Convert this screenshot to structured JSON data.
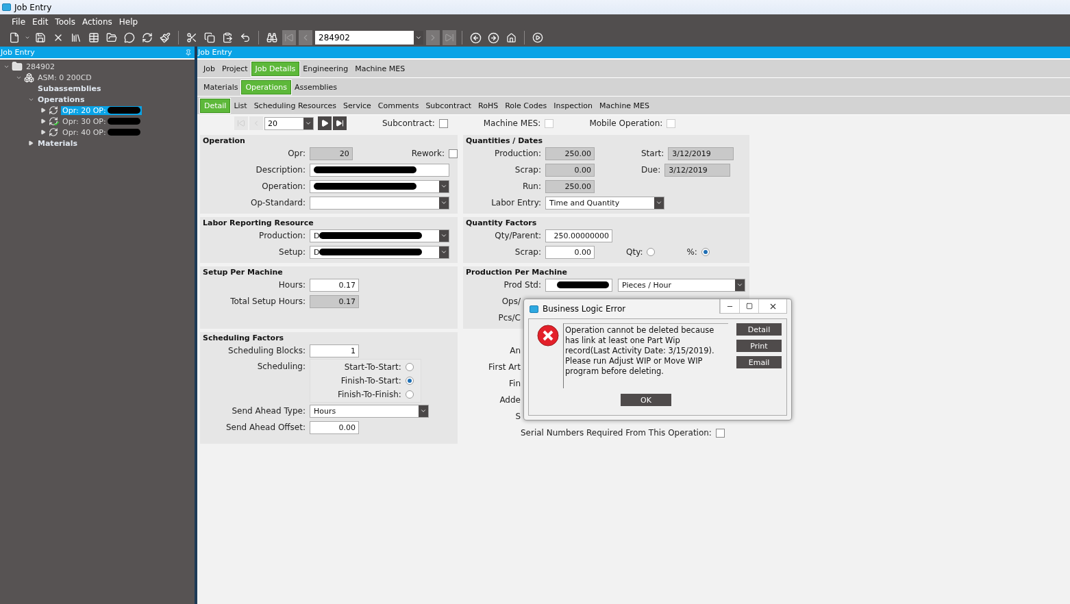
{
  "window": {
    "title": "Job Entry"
  },
  "menu": [
    "File",
    "Edit",
    "Tools",
    "Actions",
    "Help"
  ],
  "toolbar": {
    "job_number": "284902"
  },
  "tree_panel": {
    "title": "Job Entry",
    "tree": [
      {
        "label": "284902",
        "kind": "job",
        "expanded": true,
        "children": [
          {
            "label": "ASM: 0 200CD",
            "kind": "assembly",
            "expanded": true,
            "children": [
              {
                "label": "Subassemblies",
                "kind": "group"
              },
              {
                "label": "Operations",
                "kind": "group",
                "expanded": true,
                "children": [
                  {
                    "label": "Opr: 20 OP:",
                    "kind": "operation",
                    "expanded": false,
                    "selected": true,
                    "complete": false
                  },
                  {
                    "label": "Opr: 30 OP:",
                    "kind": "operation",
                    "expanded": false,
                    "selected": false,
                    "complete": true
                  },
                  {
                    "label": "Opr: 40 OP:",
                    "kind": "operation",
                    "expanded": false,
                    "selected": false,
                    "complete": false
                  }
                ]
              },
              {
                "label": "Materials",
                "kind": "group",
                "expanded": false
              }
            ]
          }
        ]
      }
    ]
  },
  "main_panel": {
    "title": "Job Entry",
    "tab_rows": [
      [
        {
          "label": "Job",
          "selected": false
        },
        {
          "label": "Project",
          "selected": false
        },
        {
          "label": "Job Details",
          "selected": true
        },
        {
          "label": "Engineering",
          "selected": false
        },
        {
          "label": "Machine MES",
          "selected": false
        }
      ],
      [
        {
          "label": "Materials",
          "selected": false
        },
        {
          "label": "Operations",
          "selected": true
        },
        {
          "label": "Assemblies",
          "selected": false
        }
      ],
      [
        {
          "label": "Detail",
          "selected": true
        },
        {
          "label": "List",
          "selected": false
        },
        {
          "label": "Scheduling Resources",
          "selected": false
        },
        {
          "label": "Service",
          "selected": false
        },
        {
          "label": "Comments",
          "selected": false
        },
        {
          "label": "Subcontract",
          "selected": false
        },
        {
          "label": "RoHS",
          "selected": false
        },
        {
          "label": "Role Codes",
          "selected": false
        },
        {
          "label": "Inspection",
          "selected": false
        },
        {
          "label": "Machine MES",
          "selected": false
        }
      ]
    ],
    "navigator": {
      "value": "20",
      "options": [
        {
          "label": "Subcontract:",
          "checked": false,
          "disabled": false
        },
        {
          "label": "Machine MES:",
          "checked": false,
          "disabled": true
        },
        {
          "label": "Mobile Operation:",
          "checked": false,
          "disabled": true
        }
      ]
    },
    "left_sections": [
      {
        "title": "Operation",
        "rows": [
          [
            {
              "kind": "readonly",
              "label": "Opr:",
              "value": "20"
            },
            {
              "kind": "check",
              "label": "Rework:",
              "checked": false
            }
          ],
          [
            {
              "kind": "text",
              "label": "Description:",
              "redacted": true
            }
          ],
          [
            {
              "kind": "combo",
              "label": "Operation:",
              "redacted": true
            }
          ],
          [
            {
              "kind": "combo",
              "label": "Op-Standard:"
            }
          ]
        ]
      },
      {
        "title": "Labor Reporting Resource",
        "rows": [
          [
            {
              "kind": "combo",
              "label": "Production:",
              "value": "D",
              "redacted": true
            }
          ],
          [
            {
              "kind": "combo",
              "label": "Setup:",
              "value": "D",
              "redacted": true
            }
          ]
        ]
      },
      {
        "title": "Setup Per Machine",
        "rows": [
          [
            {
              "kind": "number",
              "label": "Hours:",
              "value": "0.17"
            }
          ],
          [
            {
              "kind": "readonly",
              "label": "Total Setup Hours:",
              "value": "0.17"
            }
          ]
        ]
      },
      {
        "title": "Scheduling Factors",
        "rows": [
          [
            {
              "kind": "number",
              "label": "Scheduling Blocks:",
              "value": "1"
            }
          ],
          [
            {
              "kind": "radios",
              "label": "Scheduling:",
              "options": [
                {
                  "label": "Start-To-Start:",
                  "selected": false
                },
                {
                  "label": "Finish-To-Start:",
                  "selected": true
                },
                {
                  "label": "Finish-To-Finish:",
                  "selected": false
                }
              ]
            }
          ],
          [
            {
              "kind": "combo",
              "label": "Send Ahead Type:",
              "value": "Hours"
            }
          ],
          [
            {
              "kind": "number",
              "label": "Send Ahead Offset:",
              "value": "0.00"
            }
          ]
        ]
      }
    ],
    "right_sections": [
      {
        "title": "Quantities / Dates",
        "rows": [
          [
            {
              "kind": "readonly",
              "label": "Production:",
              "value": "250.00"
            },
            {
              "kind": "date",
              "label": "Start:",
              "value": "3/12/2019"
            }
          ],
          [
            {
              "kind": "readonly",
              "label": "Scrap:",
              "value": "0.00"
            },
            {
              "kind": "date",
              "label": "Due:",
              "value": "3/12/2019"
            }
          ],
          [
            {
              "kind": "readonly",
              "label": "Run:",
              "value": "250.00"
            }
          ],
          [
            {
              "kind": "combo",
              "label": "Labor Entry:",
              "value": "Time and Quantity"
            }
          ]
        ]
      },
      {
        "title": "Quantity Factors",
        "rows": [
          [
            {
              "kind": "number",
              "label": "Qty/Parent:",
              "value": "250.00000000"
            }
          ],
          [
            {
              "kind": "number",
              "label": "Scrap:",
              "value": "0.00"
            },
            {
              "kind": "radio",
              "label": "Qty:",
              "selected": false
            },
            {
              "kind": "radio",
              "label": "%:",
              "selected": true
            }
          ]
        ]
      },
      {
        "title": "Production Per Machine",
        "rows": [
          [
            {
              "kind": "number",
              "label": "Prod Std:",
              "redacted": true
            },
            {
              "kind": "combo",
              "value": "Pieces / Hour"
            }
          ],
          [
            {
              "kind": "label",
              "label": "Ops/"
            }
          ],
          [
            {
              "kind": "label",
              "label": "Pcs/C"
            }
          ]
        ]
      },
      {
        "rows": [
          [
            {
              "kind": "label",
              "label": "An"
            }
          ],
          [
            {
              "kind": "label",
              "label": "First Art"
            }
          ],
          [
            {
              "kind": "label",
              "label": "Fin"
            }
          ],
          [
            {
              "kind": "label",
              "label": "Adde"
            }
          ],
          [
            {
              "kind": "label",
              "label": "S"
            }
          ],
          [
            {
              "kind": "check",
              "label": "Serial Numbers Required From This Operation:",
              "checked": false
            }
          ]
        ]
      }
    ]
  },
  "dialog": {
    "title": "Business Logic Error",
    "message": "Operation cannot be deleted because has link at least one Part Wip  record(Last Activity Date: 3/15/2019). Please run Adjust WIP or Move WIP program before deleting.",
    "buttons": [
      "Detail",
      "Print",
      "Email"
    ],
    "ok": "OK"
  }
}
